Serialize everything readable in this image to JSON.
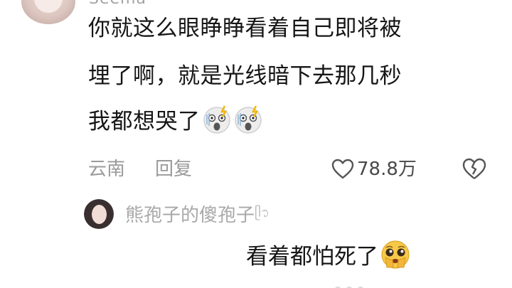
{
  "comment": {
    "username": "Seema",
    "lines": [
      "你就这么眼睁睁看着自己即将被",
      "埋了啊，就是光线暗下去那几秒",
      "我都想哭了"
    ],
    "emojis": [
      "scared-face-icon",
      "scared-face-icon"
    ],
    "location": "云南",
    "reply_label": "回复",
    "like_count": "78.8万"
  },
  "reply": {
    "username": "熊孢子的傻孢子",
    "username_decoration": "ᥫ᭡",
    "text": "看着都怕死了",
    "emoji": "pleading-face-icon"
  },
  "colors": {
    "text_primary": "#161616",
    "text_meta": "#9a9a9a",
    "emoji_yellow": "#f7c948",
    "emoji_gray": "#e6e6e6"
  }
}
